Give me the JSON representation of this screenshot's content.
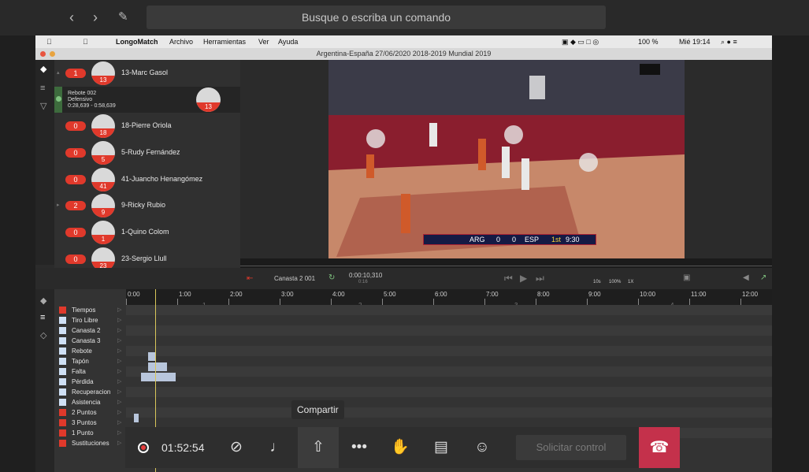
{
  "teams": {
    "search_placeholder": "Busque o escriba un comando",
    "back_icon": "chevron-left-icon",
    "forward_icon": "chevron-right-icon",
    "compose_icon": "compose-icon"
  },
  "mac_menu": {
    "app_name": "LongoMatch",
    "items": [
      "Archivo",
      "Herramientas",
      "Ver",
      "Ayuda"
    ],
    "status": {
      "battery": "100 %",
      "datetime": "Mié 19:14"
    }
  },
  "window_title": "Argentina-España 27/06/2020 2018-2019 Mundial 2019",
  "players": [
    {
      "badge": "1",
      "number": "13",
      "name": "13-Marc Gasol"
    },
    {
      "badge": "0",
      "number": "18",
      "name": "18-Pierre Oriola"
    },
    {
      "badge": "0",
      "number": "5",
      "name": "5-Rudy Fernández"
    },
    {
      "badge": "0",
      "number": "41",
      "name": "41-Juancho Henangómez"
    },
    {
      "badge": "2",
      "number": "9",
      "name": "9-Ricky Rubio"
    },
    {
      "badge": "0",
      "number": "1",
      "name": "1-Quino Colom"
    },
    {
      "badge": "0",
      "number": "23",
      "name": "23-Sergio Llull"
    }
  ],
  "event_detail": {
    "line1": "Rebote 002",
    "line2": "Defensivo",
    "line3": "0:28,639 - 0:58,639",
    "number": "13"
  },
  "scoreboard": {
    "team_a": "ARG",
    "score_a": "0",
    "score_b": "0",
    "team_b": "ESP",
    "period": "1st",
    "clock": "9:30"
  },
  "controls": {
    "event_name": "Canasta 2 001",
    "position": "0:00:10,310",
    "sub": "0:16",
    "rate1": "10s",
    "rate2": "100%",
    "rate3": "1X"
  },
  "timeline": {
    "ticks": [
      "0:00",
      "1:00",
      "2:00",
      "3:00",
      "4:00",
      "5:00",
      "6:00",
      "7:00",
      "8:00",
      "9:00",
      "10:00",
      "11:00",
      "12:00"
    ],
    "period_marks": [
      "1",
      "2",
      "3",
      "4"
    ],
    "categories": [
      {
        "label": "Tiempos",
        "color": "#e0392b"
      },
      {
        "label": "Tiro Libre",
        "color": "#cfe0f5"
      },
      {
        "label": "Canasta 2",
        "color": "#cfe0f5"
      },
      {
        "label": "Canasta 3",
        "color": "#cfe0f5"
      },
      {
        "label": "Rebote",
        "color": "#cfe0f5"
      },
      {
        "label": "Tapón",
        "color": "#cfe0f5"
      },
      {
        "label": "Falta",
        "color": "#cfe0f5"
      },
      {
        "label": "Pérdida",
        "color": "#cfe0f5"
      },
      {
        "label": "Recuperacion",
        "color": "#cfe0f5"
      },
      {
        "label": "Asistencia",
        "color": "#cfe0f5"
      },
      {
        "label": "2 Puntos",
        "color": "#e0392b"
      },
      {
        "label": "3 Puntos",
        "color": "#e0392b"
      },
      {
        "label": "1 Punto",
        "color": "#e0392b"
      },
      {
        "label": "Sustituciones",
        "color": "#e0392b"
      }
    ]
  },
  "call": {
    "tooltip": "Compartir",
    "timer": "01:52:54",
    "request_control": "Solicitar control"
  }
}
